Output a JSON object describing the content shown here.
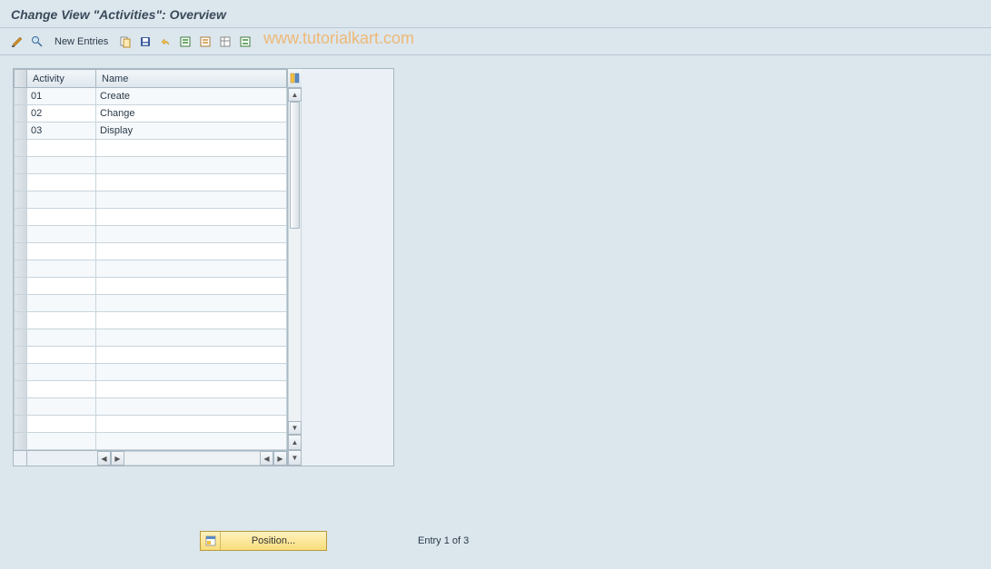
{
  "page_title": "Change View \"Activities\": Overview",
  "toolbar": {
    "new_entries_label": "New Entries"
  },
  "watermark": "www.tutorialkart.com",
  "table": {
    "headers": {
      "activity": "Activity",
      "name": "Name"
    },
    "rows": [
      {
        "activity": "01",
        "name": "Create"
      },
      {
        "activity": "02",
        "name": "Change"
      },
      {
        "activity": "03",
        "name": "Display"
      }
    ],
    "empty_rows": 18
  },
  "footer": {
    "position_label": "Position...",
    "entry_status": "Entry 1 of 3"
  }
}
